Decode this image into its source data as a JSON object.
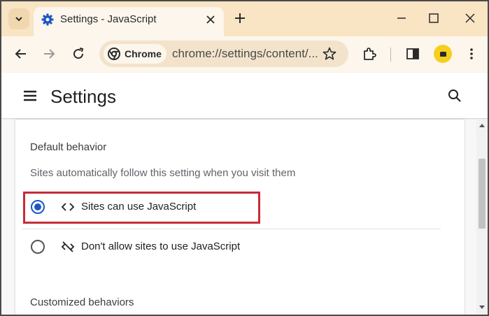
{
  "browser": {
    "tab_title": "Settings - JavaScript",
    "chip_label": "Chrome",
    "url": "chrome://settings/content/...",
    "icons": [
      "chevron-down-icon",
      "settings-gear-icon",
      "close-icon",
      "plus-icon",
      "minimize-icon",
      "maximize-icon",
      "close-window-icon",
      "back-arrow-icon",
      "forward-arrow-icon",
      "reload-icon",
      "chrome-logo-icon",
      "star-icon",
      "extensions-icon",
      "side-panel-icon",
      "profile-icon",
      "more-vert-icon"
    ]
  },
  "settings": {
    "title": "Settings",
    "section_default": "Default behavior",
    "section_default_desc": "Sites automatically follow this setting when you visit them",
    "options": [
      {
        "label": "Sites can use JavaScript",
        "selected": true,
        "icon": "code-brackets-icon"
      },
      {
        "label": "Don't allow sites to use JavaScript",
        "selected": false,
        "icon": "code-off-icon"
      }
    ],
    "section_custom": "Customized behaviors"
  },
  "colors": {
    "tabstrip": "#f9e4c4",
    "toolbar": "#fdf6ec",
    "radio_selected": "#1a57c5",
    "highlight_box": "#c72b37"
  }
}
